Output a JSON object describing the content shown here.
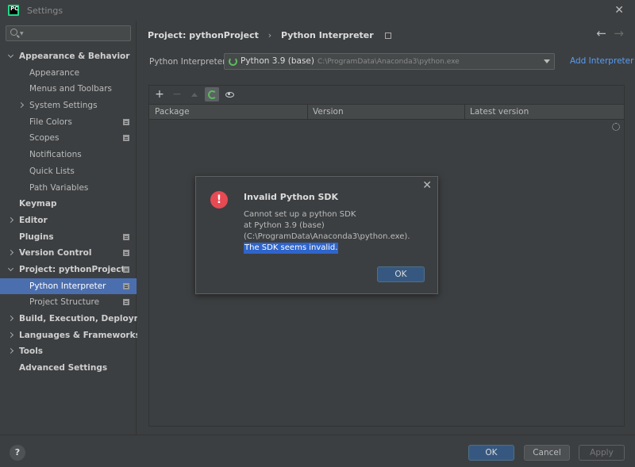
{
  "window": {
    "title": "Settings",
    "logo_text": "PC"
  },
  "sidebar": {
    "search_placeholder": "",
    "items": [
      {
        "label": "Appearance & Behavior",
        "level": 0,
        "expanded": true,
        "bold": true,
        "has_icon": false,
        "selected": false
      },
      {
        "label": "Appearance",
        "level": 1,
        "has_icon": false
      },
      {
        "label": "Menus and Toolbars",
        "level": 1,
        "has_icon": false
      },
      {
        "label": "System Settings",
        "level": 1,
        "collapsed": true,
        "has_icon": false
      },
      {
        "label": "File Colors",
        "level": 1,
        "has_icon": true
      },
      {
        "label": "Scopes",
        "level": 1,
        "has_icon": true
      },
      {
        "label": "Notifications",
        "level": 1,
        "has_icon": false
      },
      {
        "label": "Quick Lists",
        "level": 1,
        "has_icon": false
      },
      {
        "label": "Path Variables",
        "level": 1,
        "has_icon": false
      },
      {
        "label": "Keymap",
        "level": 0,
        "bold": true,
        "has_icon": false
      },
      {
        "label": "Editor",
        "level": 0,
        "collapsed": true,
        "bold": true,
        "has_icon": false
      },
      {
        "label": "Plugins",
        "level": 0,
        "bold": true,
        "has_icon": true
      },
      {
        "label": "Version Control",
        "level": 0,
        "collapsed": true,
        "bold": true,
        "has_icon": true
      },
      {
        "label": "Project: pythonProject",
        "level": 0,
        "expanded": true,
        "bold": true,
        "has_icon": true
      },
      {
        "label": "Python Interpreter",
        "level": 1,
        "has_icon": true,
        "selected": true
      },
      {
        "label": "Project Structure",
        "level": 1,
        "has_icon": true
      },
      {
        "label": "Build, Execution, Deployment",
        "level": 0,
        "collapsed": true,
        "bold": true,
        "has_icon": false
      },
      {
        "label": "Languages & Frameworks",
        "level": 0,
        "collapsed": true,
        "bold": true,
        "has_icon": false
      },
      {
        "label": "Tools",
        "level": 0,
        "collapsed": true,
        "bold": true,
        "has_icon": false
      },
      {
        "label": "Advanced Settings",
        "level": 0,
        "bold": true,
        "has_icon": false
      }
    ]
  },
  "breadcrumb": {
    "parent": "Project: pythonProject",
    "current": "Python Interpreter"
  },
  "interpreter": {
    "label": "Python Interpreter:",
    "value": "Python 3.9 (base)",
    "path": "C:\\ProgramData\\Anaconda3\\python.exe",
    "add_label": "Add Interpreter"
  },
  "toolbar": {
    "add": "+",
    "remove": "−"
  },
  "table": {
    "columns": [
      "Package",
      "Version",
      "Latest version"
    ]
  },
  "dialog": {
    "title": "Invalid Python SDK",
    "icon_glyph": "!",
    "lines": [
      "Cannot set up a python SDK",
      "at Python 3.9 (base)",
      "(C:\\ProgramData\\Anaconda3\\python.exe)."
    ],
    "highlighted": "The SDK seems invalid.",
    "ok_label": "OK"
  },
  "footer": {
    "help": "?",
    "ok": "OK",
    "cancel": "Cancel",
    "apply": "Apply"
  },
  "colors": {
    "selection": "#4b6eaf",
    "link": "#589df6",
    "error": "#e64a53",
    "primary_button": "#365880"
  }
}
